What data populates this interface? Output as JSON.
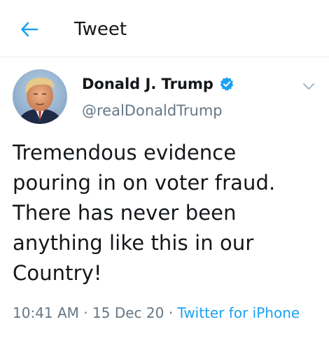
{
  "header": {
    "title": "Tweet",
    "back_icon": "arrow-left-icon"
  },
  "author": {
    "name": "Donald J. Trump",
    "handle": "@realDonaldTrump",
    "verified": true
  },
  "tweet": {
    "text": "Tremendous evidence\npouring in on voter fraud.\nThere has never been\nanything like this in our\nCountry!",
    "time": "10:41 AM",
    "separator": "·",
    "date": "15 Dec 20",
    "source": "Twitter for iPhone"
  },
  "colors": {
    "accent": "#1da1f2",
    "secondary_text": "#657786",
    "primary_text": "#14171a",
    "divider": "#e6ecf0"
  }
}
